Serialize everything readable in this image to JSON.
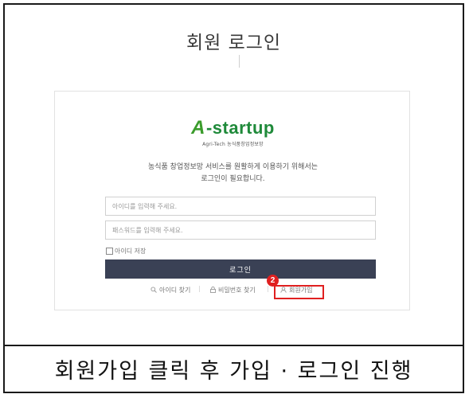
{
  "page": {
    "title": "회원 로그인"
  },
  "logo": {
    "a_mark": "A",
    "name": "-startup",
    "tagline": "Agri-Tech 농식품창업정보망"
  },
  "description": {
    "line1": "농식품 창업정보망 서비스를 원활하게 이용하기 위해서는",
    "line2": "로그인이 필요합니다."
  },
  "form": {
    "id_placeholder": "아이디를 입력해 주세요.",
    "pw_placeholder": "패스워드를 입력해 주세요.",
    "save_id_label": "아이디 저장",
    "login_button": "로그인"
  },
  "links": {
    "find_id": "아이디 찾기",
    "find_pw": "비밀번호 찾기",
    "signup": "회원가입",
    "separator": "|"
  },
  "icons": {
    "find_id": "search-icon",
    "find_pw": "lock-icon",
    "signup": "user-icon"
  },
  "annotation": {
    "step_number": "2",
    "highlight_color": "#e02020"
  },
  "caption": {
    "text": "회원가입 클릭 후 가입 · 로그인 진행"
  },
  "colors": {
    "login_button_bg": "#3a4155",
    "logo_green": "#1f8a3a"
  }
}
